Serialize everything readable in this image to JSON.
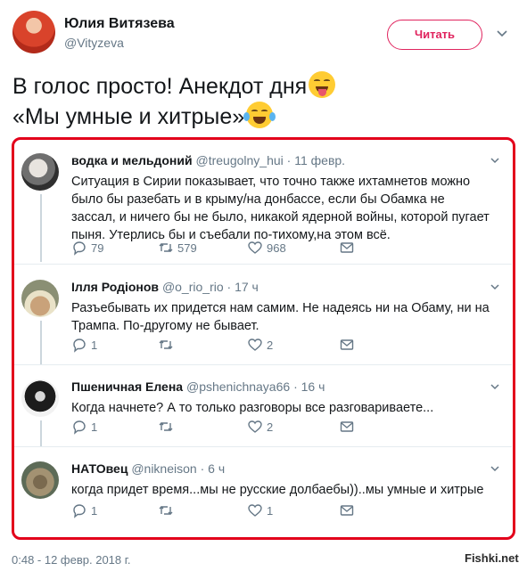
{
  "author": {
    "name": "Юлия Витязева",
    "handle": "@Vityzeva"
  },
  "follow_button": "Читать",
  "tweet": {
    "line1": "В голос просто! Анекдот дня",
    "line2": "«Мы умные и хитрые»"
  },
  "replies": [
    {
      "name": "водка и мельдоний",
      "handle": "@treugolny_hui",
      "sep": "·",
      "time": "11 февр.",
      "text": "Ситуация в Сирии показывает, что точно также ихтамнетов можно было бы разебать и в крыму/на донбассе, если бы Обамка не зассал, и ничего бы не было, никакой ядерной войны, которой пугает пыня. Утерлись бы и съебали по-тихому,на этом всё.",
      "reply_count": "79",
      "retweet_count": "579",
      "like_count": "968"
    },
    {
      "name": "Ілля Родіонов",
      "handle": "@o_rio_rio",
      "sep": "·",
      "time": "17 ч",
      "text": "Разъебывать их придется нам самим. Не надеясь ни на Обаму, ни на Трампа. По-другому не бывает.",
      "reply_count": "1",
      "retweet_count": "",
      "like_count": "2"
    },
    {
      "name": "Пшеничная Елена",
      "handle": "@pshenichnaya66",
      "sep": "·",
      "time": "16 ч",
      "text": "Когда начнете? А то только разговоры все разговариваете...",
      "reply_count": "1",
      "retweet_count": "",
      "like_count": "2"
    },
    {
      "name": "НАТОвец",
      "handle": "@nikneison",
      "sep": "·",
      "time": "6 ч",
      "text": "когда придет время...мы не русские долбаебы))..мы умные и хитрые",
      "reply_count": "1",
      "retweet_count": "",
      "like_count": "1"
    }
  ],
  "footer": {
    "date": "0:48 - 12 февр. 2018 г.",
    "watermark": "Fishki.net"
  },
  "colors": {
    "accent": "#e0245e",
    "highlight_border": "#e3001b",
    "muted": "#657786"
  }
}
